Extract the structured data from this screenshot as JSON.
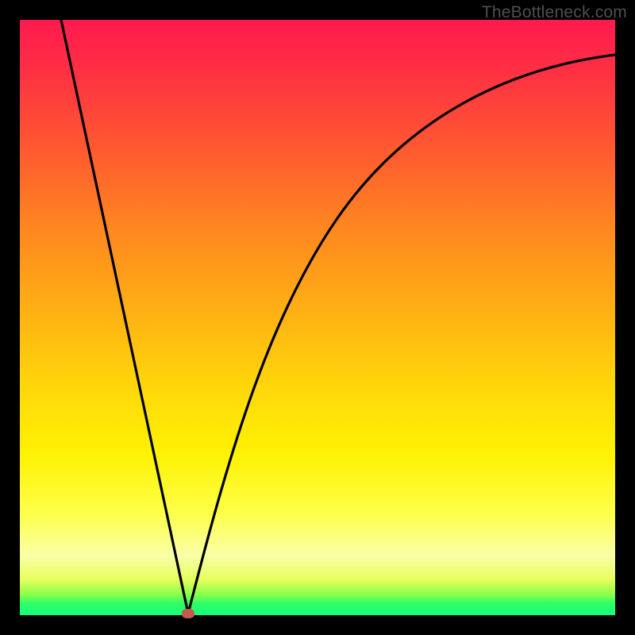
{
  "watermark": "TheBottleneck.com",
  "colors": {
    "gradient_top": "#ff1a4f",
    "gradient_bottom": "#15ff7a",
    "curve": "#000000",
    "marker": "#c5584f",
    "frame": "#000000"
  },
  "chart_data": {
    "type": "line",
    "title": "",
    "xlabel": "",
    "ylabel": "",
    "xlim": [
      0,
      100
    ],
    "ylim": [
      0,
      100
    ],
    "grid": false,
    "legend": false,
    "series": [
      {
        "name": "bottleneck-curve",
        "x": [
          7,
          10,
          13,
          16,
          19,
          22,
          25,
          27,
          28,
          30,
          33,
          36,
          40,
          45,
          50,
          55,
          60,
          65,
          70,
          75,
          80,
          85,
          90,
          95,
          100
        ],
        "y": [
          100,
          88,
          76,
          64,
          52,
          40,
          28,
          12,
          0,
          10,
          24,
          36,
          48,
          58,
          66,
          72,
          77,
          81,
          84,
          87,
          89,
          91,
          92.5,
          93.5,
          94
        ]
      }
    ],
    "marker": {
      "x": 28,
      "y": 0
    }
  }
}
